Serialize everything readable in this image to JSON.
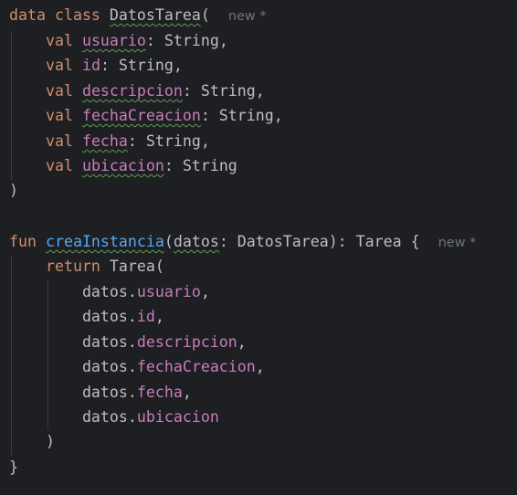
{
  "colors": {
    "background": "#1e1f22",
    "keyword": "#cf8e6d",
    "function": "#56a8f5",
    "property": "#c77dbb",
    "text": "#bcbec4",
    "hint": "#6f737a",
    "typo_underline": "#5f9a5a"
  },
  "code": {
    "class_decl": {
      "kw_data": "data",
      "kw_class": "class",
      "name": "DatosTarea",
      "open": "(",
      "hint": "new *"
    },
    "fields": [
      {
        "kw": "val",
        "name": "usuario",
        "type": ": String,"
      },
      {
        "kw": "val",
        "name": "id",
        "type": ": String,"
      },
      {
        "kw": "val",
        "name": "descripcion",
        "type": ": String,"
      },
      {
        "kw": "val",
        "name": "fechaCreacion",
        "type": ": String,"
      },
      {
        "kw": "val",
        "name": "fecha",
        "type": ": String,"
      },
      {
        "kw": "val",
        "name": "ubicacion",
        "type": ": String"
      }
    ],
    "class_close": ")",
    "fun_decl": {
      "kw_fun": "fun",
      "name": "creaInstancia",
      "open": "(",
      "param": "datos",
      "rest": ": DatosTarea): Tarea {",
      "hint": "new *"
    },
    "return_line": {
      "kw": "return",
      "rest": "Tarea("
    },
    "args": [
      {
        "receiver": "datos.",
        "prop": "usuario",
        "sep": ","
      },
      {
        "receiver": "datos.",
        "prop": "id",
        "sep": ","
      },
      {
        "receiver": "datos.",
        "prop": "descripcion",
        "sep": ","
      },
      {
        "receiver": "datos.",
        "prop": "fechaCreacion",
        "sep": ","
      },
      {
        "receiver": "datos.",
        "prop": "fecha",
        "sep": ","
      },
      {
        "receiver": "datos.",
        "prop": "ubicacion",
        "sep": ""
      }
    ],
    "call_close": ")",
    "fun_close": "}"
  }
}
